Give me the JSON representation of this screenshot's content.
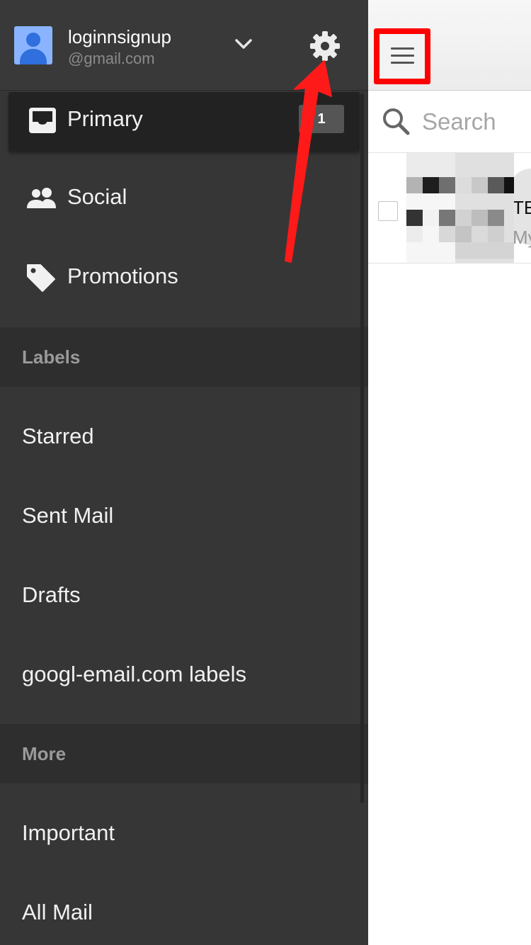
{
  "account": {
    "name": "loginnsignup",
    "email": "@gmail.com"
  },
  "nav": {
    "primary": {
      "label": "Primary",
      "badge": "1"
    },
    "social": {
      "label": "Social"
    },
    "promotions": {
      "label": "Promotions"
    }
  },
  "sections": {
    "labels": "Labels",
    "more": "More"
  },
  "labels": {
    "starred": "Starred",
    "sent_mail": "Sent Mail",
    "drafts": "Drafts",
    "googl_labels": "googl-email.com labels"
  },
  "more_items": {
    "important": "Important",
    "all_mail": "All Mail"
  },
  "mail": {
    "search_placeholder": "Search",
    "row": {
      "sender_fragment": "TE",
      "snippet_fragment": "My"
    }
  },
  "colors": {
    "drawer_bg": "#363636",
    "highlight_red": "#ff0000",
    "avatar_blue": "#8ab4ff"
  },
  "icons": {
    "menu": "hamburger-icon",
    "search": "search-icon",
    "settings": "gear-icon",
    "account_switch": "chevron-down-icon",
    "primary": "inbox-icon",
    "social": "people-icon",
    "promotions": "tag-icon"
  }
}
